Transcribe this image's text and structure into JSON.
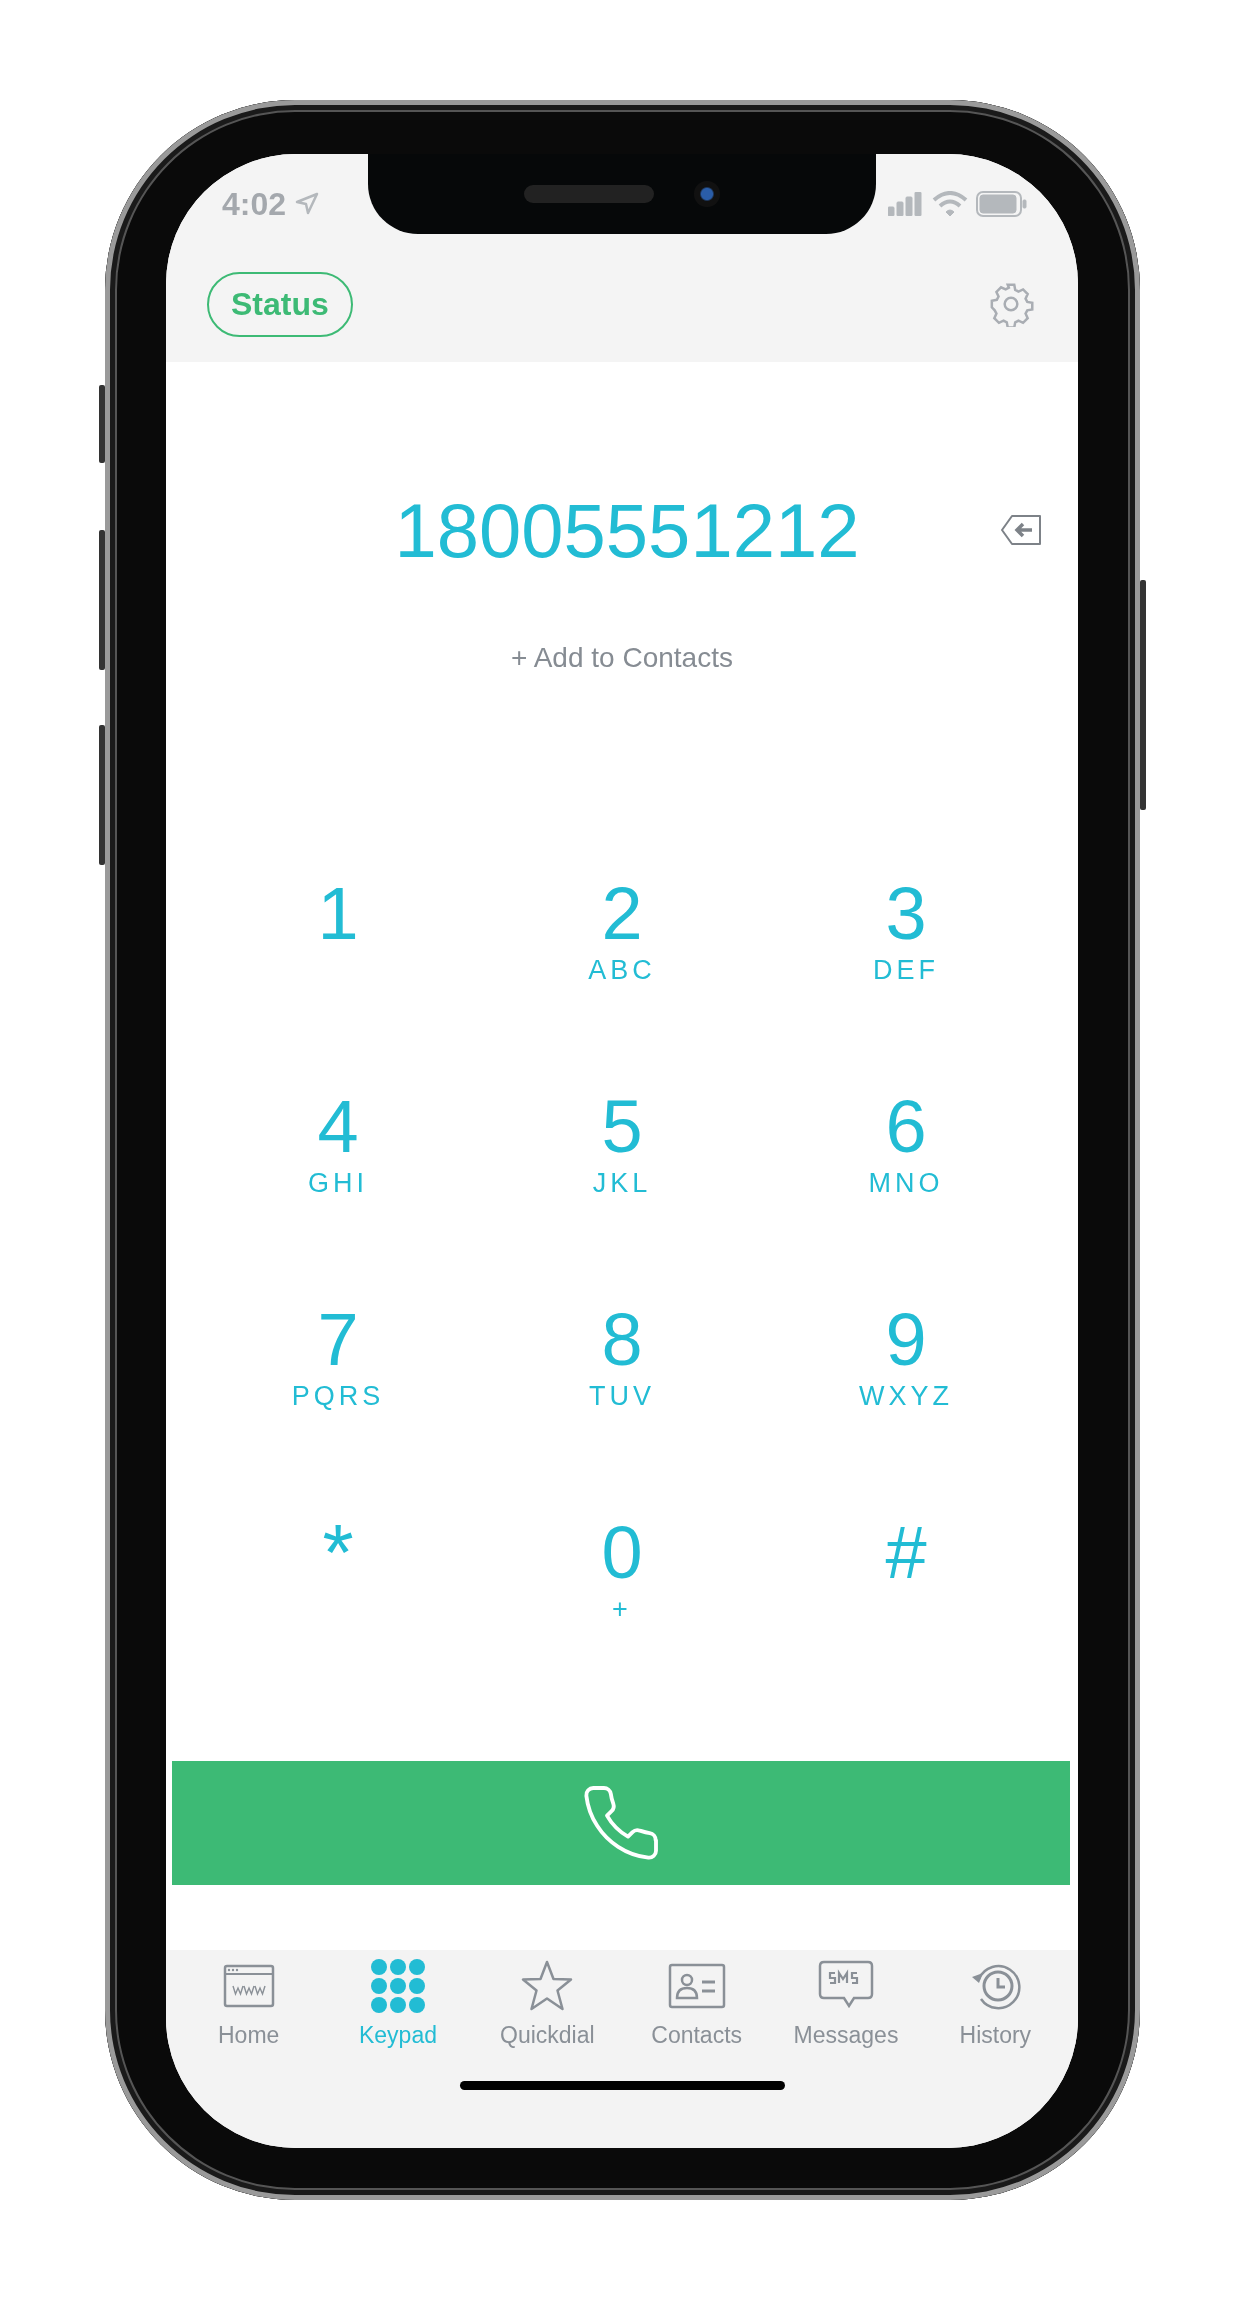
{
  "status_bar": {
    "time": "4:02"
  },
  "header": {
    "status_button": "Status"
  },
  "dialer": {
    "number": "18005551212",
    "add_contact": "+ Add to Contacts"
  },
  "keys": [
    {
      "digit": "1"
    },
    {
      "digit": "2",
      "letters": "ABC"
    },
    {
      "digit": "3",
      "letters": "DEF"
    },
    {
      "digit": "4",
      "letters": "GHI"
    },
    {
      "digit": "5",
      "letters": "JKL"
    },
    {
      "digit": "6",
      "letters": "MNO"
    },
    {
      "digit": "7",
      "letters": "PQRS"
    },
    {
      "digit": "8",
      "letters": "TUV"
    },
    {
      "digit": "9",
      "letters": "WXYZ"
    },
    {
      "digit": "*"
    },
    {
      "digit": "0",
      "letters": "+"
    },
    {
      "digit": "#"
    }
  ],
  "tabs": [
    {
      "kind": "home",
      "label": "Home",
      "selected": false
    },
    {
      "kind": "keypad",
      "label": "Keypad",
      "selected": true
    },
    {
      "kind": "quickdial",
      "label": "Quickdial",
      "selected": false
    },
    {
      "kind": "contacts",
      "label": "Contacts",
      "selected": false
    },
    {
      "kind": "messages",
      "label": "Messages",
      "selected": false
    },
    {
      "kind": "history",
      "label": "History",
      "selected": false
    }
  ]
}
